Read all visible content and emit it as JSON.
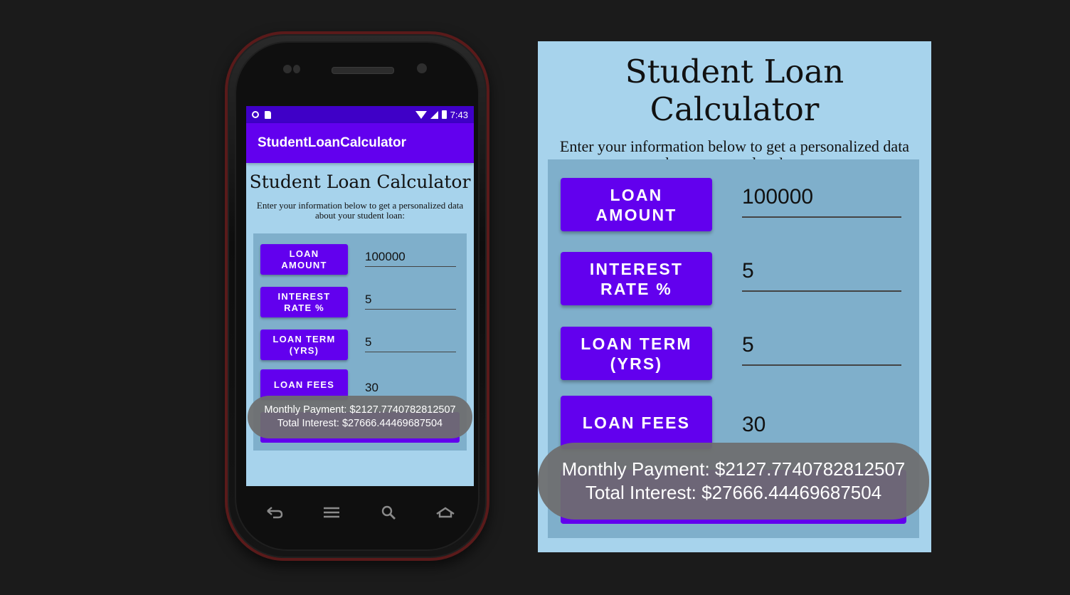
{
  "status_bar": {
    "time": "7:43"
  },
  "app_bar": {
    "title": "StudentLoanCalculator"
  },
  "heading": "Student Loan Calculator",
  "subheading": "Enter your information below to get a personalized data about your student loan:",
  "fields": [
    {
      "button_label": "LOAN\nAMOUNT",
      "value": "100000"
    },
    {
      "button_label": "INTEREST\nRATE %",
      "value": "5"
    },
    {
      "button_label": "LOAN TERM\n(YRS)",
      "value": "5"
    },
    {
      "button_label": "LOAN FEES",
      "value": "30"
    }
  ],
  "toast": {
    "line1": "Monthly Payment: $2127.7740782812507",
    "line2": "Total Interest: $27666.44469687504"
  },
  "colors": {
    "primary": "#6200ee",
    "status_bar": "#3f00c7",
    "screen_bg": "#a7d3ec",
    "panel_bg": "#7fafcb",
    "toast_bg": "#6e6e6e"
  },
  "nav_icons": [
    "back-icon",
    "menu-icon",
    "search-icon",
    "home-icon"
  ]
}
